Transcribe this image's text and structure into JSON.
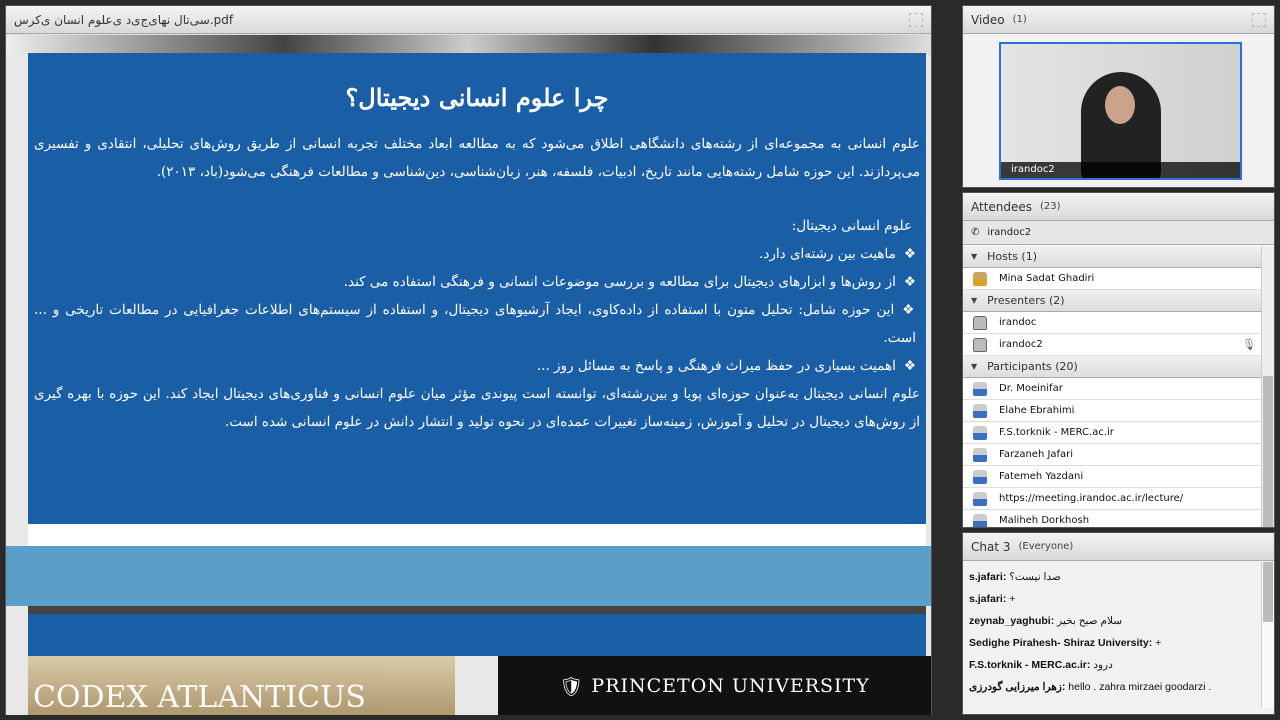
{
  "share": {
    "title": "سی‌تال نهای‌ج‌ی‌د ی‌علوم انسان ی‌کرس.pdf",
    "slide": {
      "heading": "چرا علوم انسانی دیجیتال؟",
      "intro": "علوم انسانی به مجموعه‌ای از رشته‌های دانشگاهی اطلاق می‌شود که به مطالعه ابعاد مختلف تجربه انسانی از طریق روش‌های تحلیلی، انتقادی و تفسیری می‌پردازند. این حوزه شامل رشته‌هایی مانند تاریخ، ادبیات، فلسفه، هنر، زبان‌شناسی، دین‌شناسی و مطالعات فرهنگی می‌شود(باد، ۲۰۱۳).",
      "subheading": "علوم انسانی دیجیتال:",
      "bullets": [
        "ماهیت بین رشته‌ای دارد.",
        "از روش‌ها و ابزارهای دیجیتال برای مطالعه و بررسی موضوعات انسانی و فرهنگی استفاده می کند.",
        "این حوزه شامل: تحلیل متون با استفاده از داده‌کاوی، ایجاد آرشیوهای دیجیتال، و استفاده از سیستم‌های اطلاعات جغرافیایی در مطالعات تاریخی و ... است.",
        "اهمیت بسیاری در حفظ میراث فرهنگی و پاسخ به مسائل روز ..."
      ],
      "conclusion": "علوم انسانی دیجیتال به‌عنوان حوزه‌ای پویا و بین‌رشته‌ای، توانسته است پیوندی مؤثر میان علوم انسانی و فناوری‌های دیجیتال ایجاد کند. این حوزه با بهره گیری از روش‌های دیجیتال در تحلیل و آموزش، زمینه‌ساز تغییرات عمده‌ای در نحوه تولید و انتشار دانش در علوم انسانی شده است."
    },
    "next_slide": {
      "codex": "CODEX ATLANTICUS",
      "princeton": "PRINCETON UNIVERSITY"
    }
  },
  "video": {
    "title": "Video",
    "count": "(1)",
    "label": "irandoc2"
  },
  "attendees": {
    "title": "Attendees",
    "count": "(23)",
    "phone_user": "irandoc2",
    "sections": [
      {
        "label": "Hosts (1)",
        "type": "host",
        "people": [
          {
            "name": "Mina Sadat  Ghadiri"
          }
        ]
      },
      {
        "label": "Presenters (2)",
        "type": "pres",
        "people": [
          {
            "name": "irandoc"
          },
          {
            "name": "irandoc2",
            "mic": true
          }
        ]
      },
      {
        "label": "Participants (20)",
        "type": "part",
        "people": [
          {
            "name": "Dr. Moeinifar"
          },
          {
            "name": "Elahe Ebrahimi"
          },
          {
            "name": "F.S.torknik - MERC.ac.ir"
          },
          {
            "name": "Farzaneh Jafari"
          },
          {
            "name": "Fatemeh Yazdani"
          },
          {
            "name": "https://meeting.irandoc.ac.ir/lecture/"
          },
          {
            "name": "Maliheh Dorkhosh"
          }
        ]
      }
    ]
  },
  "chat": {
    "title": "Chat 3",
    "scope": "(Everyone)",
    "messages": [
      {
        "from": "s.jafari:",
        "text": "صدا نیست؟"
      },
      {
        "from": "s.jafari:",
        "text": "+"
      },
      {
        "from": "zeynab_yaghubi:",
        "text": "سلام صبح بخیر"
      },
      {
        "from": "Sedighe Pirahesh- Shiraz University:",
        "text": "+"
      },
      {
        "from": "F.S.torknik - MERC.ac.ir:",
        "text": "درود"
      },
      {
        "from": "زهرا میرزایی گودرزی:",
        "text": "hello  . zahra mirzaei goodarzi ."
      }
    ]
  }
}
